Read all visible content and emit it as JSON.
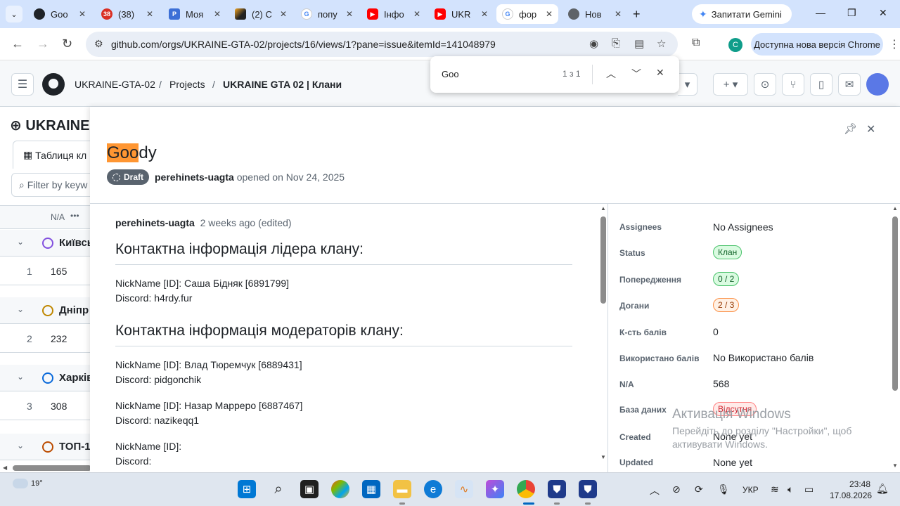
{
  "browser": {
    "tabs": [
      {
        "title": "Goo",
        "favicon": "github-icon",
        "color": "#1f2328",
        "badge": "",
        "active": false
      },
      {
        "title": "(38)",
        "favicon": "mail-icon",
        "color": "#d93025",
        "badge": "38",
        "active": false
      },
      {
        "title": "Моя",
        "favicon": "p-icon",
        "color": "#3c6fd6",
        "badge": "P",
        "active": false
      },
      {
        "title": "(2) С",
        "favicon": "game-icon",
        "color": "#222222",
        "badge": "",
        "active": false
      },
      {
        "title": "попу",
        "favicon": "google-icon",
        "color": "#4285f4",
        "badge": "G",
        "active": false
      },
      {
        "title": "Інфо",
        "favicon": "youtube-icon",
        "color": "#ff0000",
        "badge": "▶",
        "active": false
      },
      {
        "title": "UKR",
        "favicon": "youtube-icon",
        "color": "#ff0000",
        "badge": "▶",
        "active": false
      },
      {
        "title": "фор",
        "favicon": "google-icon",
        "color": "#4285f4",
        "badge": "G",
        "active": true
      },
      {
        "title": "Нов",
        "favicon": "chrome-icon",
        "color": "#5f6368",
        "badge": "",
        "active": false
      }
    ],
    "gemini_label": "Запитати Gemini",
    "url": "github.com/orgs/UKRAINE-GTA-02/projects/16/views/1?pane=issue&itemId=141048979",
    "profile_letter": "C",
    "update_label": "Доступна нова версія Chrome"
  },
  "header": {
    "org": "UKRAINE-GTA-02",
    "sep": "/",
    "projects": "Projects",
    "project": "UKRAINE GTA 02 | Клани"
  },
  "find": {
    "query": "Goo",
    "count": "1 з 1"
  },
  "background": {
    "title": "UKRAINE G",
    "tab_label": "Таблиця кл",
    "filter_placeholder": "Filter by keyw",
    "column": "N/A",
    "column_more": "•••",
    "groups": [
      {
        "name": "Київсь",
        "color": "#8250df",
        "row_num": "1",
        "row_val": "165"
      },
      {
        "name": "Дніпр",
        "color": "#bf8700",
        "row_num": "2",
        "row_val": "232"
      },
      {
        "name": "Харків",
        "color": "#0969da",
        "row_num": "3",
        "row_val": "308"
      },
      {
        "name": "ТОП-1",
        "color": "#bc4c00",
        "row_num": "",
        "row_val": ""
      }
    ]
  },
  "issue": {
    "title_match": "Goo",
    "title_rest": "dy",
    "state": "Draft",
    "author": "perehinets-uagta",
    "opened_text": "opened on Nov 24, 2025",
    "comment_author": "perehinets-uagta",
    "comment_time": "2 weeks ago (edited)",
    "leader_heading": "Контактна інформація лідера клану:",
    "leader_nick": "NickName [ID]: Саша Бідняк [6891799]",
    "leader_discord": "Discord: h4rdy.fur",
    "mods_heading": "Контактна інформація модераторів клану:",
    "mods": [
      {
        "nick": "NickName [ID]: Влад Тюремчук [6889431]",
        "discord": "Discord: pidgonchik"
      },
      {
        "nick": "NickName [ID]: Назар Марреро [6887467]",
        "discord": "Discord: nazikeqq1"
      },
      {
        "nick": "NickName [ID]:",
        "discord": "Discord:"
      }
    ]
  },
  "fields": {
    "assignees_label": "Assignees",
    "assignees_value": "No Assignees",
    "status_label": "Status",
    "status_value": "Клан",
    "warnings_label": "Попередження",
    "warnings_value": "0 / 2",
    "reprimands_label": "Догани",
    "reprimands_value": "2 / 3",
    "points_label": "К-сть балів",
    "points_value": "0",
    "used_label": "Використано балів",
    "used_value": "No Використано балів",
    "na_label": "N/A",
    "na_value": "568",
    "db_label": "База даних",
    "db_value": "Відсутня",
    "created_label": "Created",
    "created_value": "None yet",
    "updated_label": "Updated",
    "updated_value": "None yet"
  },
  "watermark": {
    "title": "Активація Windows",
    "subtitle": "Перейдіть до розділу \"Настройки\", щоб активувати Windows."
  },
  "taskbar": {
    "temperature": "19°",
    "lang": "УКР",
    "time": "23:48",
    "date": "17.08.2026"
  }
}
